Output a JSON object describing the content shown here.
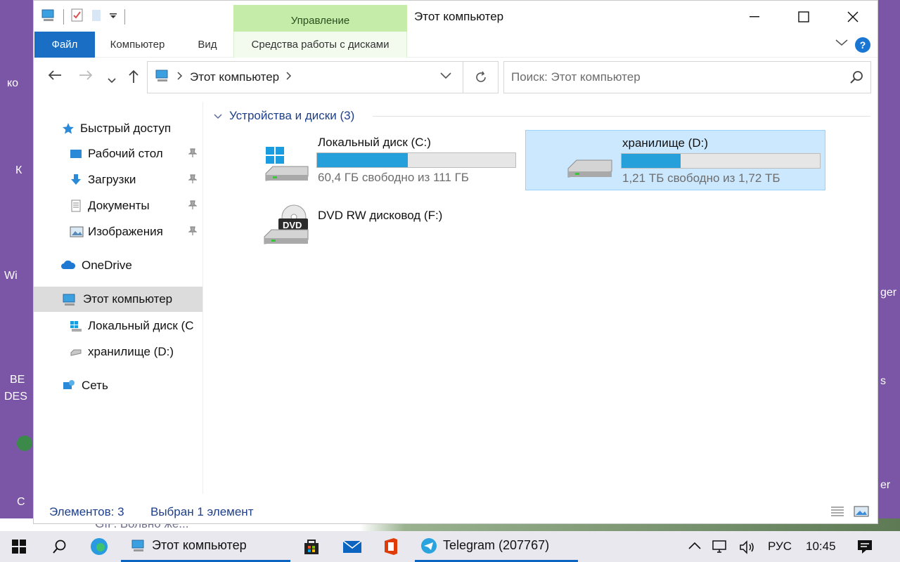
{
  "window": {
    "title": "Этот компьютер",
    "manage_tab": "Управление"
  },
  "ribbon": {
    "tabs": [
      {
        "label": "Файл"
      },
      {
        "label": "Компьютер"
      },
      {
        "label": "Вид"
      },
      {
        "label": "Средства работы с дисками"
      }
    ],
    "help": "?"
  },
  "address": {
    "path": "Этот компьютер",
    "search_placeholder": "Поиск: Этот компьютер"
  },
  "sidebar": {
    "items": [
      {
        "label": "Быстрый доступ",
        "icon": "star-icon"
      },
      {
        "label": "Рабочий стол",
        "icon": "desktop-icon"
      },
      {
        "label": "Загрузки",
        "icon": "download-icon"
      },
      {
        "label": "Документы",
        "icon": "documents-icon"
      },
      {
        "label": "Изображения",
        "icon": "pictures-icon"
      },
      {
        "label": "OneDrive",
        "icon": "cloud-icon"
      },
      {
        "label": "Этот компьютер",
        "icon": "computer-icon"
      },
      {
        "label": "Локальный диск (C",
        "icon": "windows-drive-icon"
      },
      {
        "label": "хранилище (D:)",
        "icon": "drive-icon"
      },
      {
        "label": "Сеть",
        "icon": "network-icon"
      }
    ]
  },
  "content": {
    "group_title": "Устройства и диски (3)",
    "drives": [
      {
        "name": "Локальный диск (C:)",
        "free": "60,4 ГБ свободно из 111 ГБ",
        "used_fraction": 0.456
      },
      {
        "name": "хранилище (D:)",
        "free": "1,21 ТБ свободно из 1,72 ТБ",
        "used_fraction": 0.297
      },
      {
        "name": "DVD RW дисковод (F:)"
      }
    ],
    "dvd_label": "DVD"
  },
  "status": {
    "count": "Элементов: 3",
    "selected": "Выбран 1 элемент"
  },
  "desktop": {
    "labels": [
      "ко",
      "К",
      "Wi",
      "BE",
      "DES",
      "C",
      "ger",
      "s",
      "er"
    ],
    "strip_text": "GIF. Больно же..."
  },
  "taskbar": {
    "explorer": "Этот компьютер",
    "telegram": "Telegram (207767)",
    "lang": "РУС",
    "time": "10:45"
  },
  "colors": {
    "accent": "#1a6ec4",
    "bar_fill": "#26a0da",
    "manage_tab": "#c6ecaa",
    "selection": "#cce8ff"
  }
}
